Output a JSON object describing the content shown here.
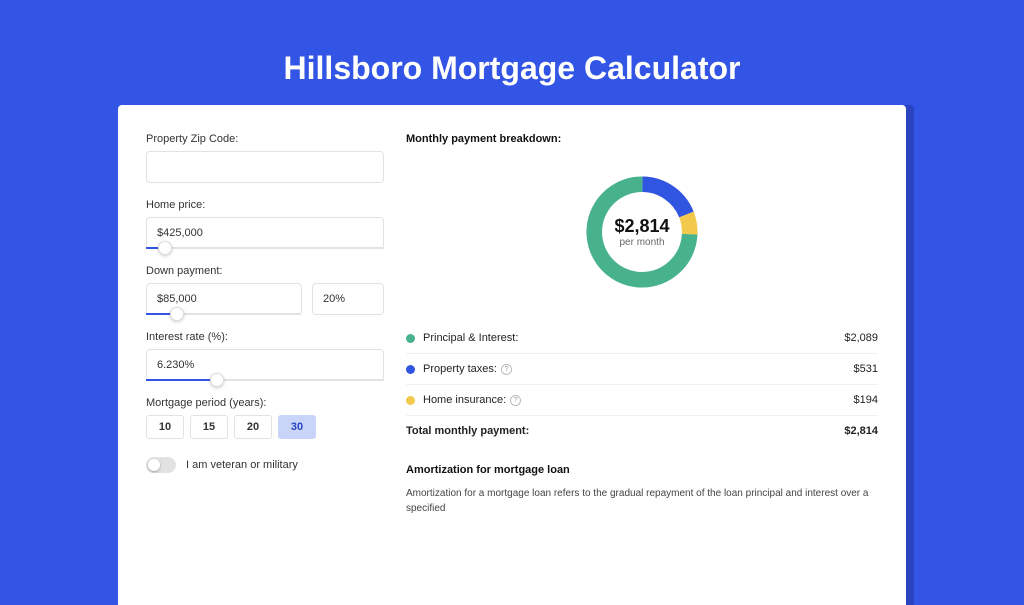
{
  "title": "Hillsboro Mortgage Calculator",
  "form": {
    "zip_label": "Property Zip Code:",
    "zip_value": "",
    "home_price_label": "Home price:",
    "home_price_value": "$425,000",
    "home_price_slider_pct": 8,
    "down_label": "Down payment:",
    "down_value": "$85,000",
    "down_percent": "20%",
    "down_slider_pct": 20,
    "rate_label": "Interest rate (%):",
    "rate_value": "6.230%",
    "rate_slider_pct": 30,
    "period_label": "Mortgage period (years):",
    "periods": [
      "10",
      "15",
      "20",
      "30"
    ],
    "period_active": "30",
    "veteran_label": "I am veteran or military"
  },
  "breakdown": {
    "title": "Monthly payment breakdown:",
    "donut_value": "$2,814",
    "donut_sub": "per month",
    "rows": [
      {
        "color": "#47b28c",
        "label": "Principal & Interest:",
        "info": false,
        "value": "$2,089"
      },
      {
        "color": "#3055e0",
        "label": "Property taxes:",
        "info": true,
        "value": "$531"
      },
      {
        "color": "#f2c94c",
        "label": "Home insurance:",
        "info": true,
        "value": "$194"
      }
    ],
    "total_label": "Total monthly payment:",
    "total_value": "$2,814"
  },
  "chart_data": {
    "type": "pie",
    "title": "Monthly payment breakdown",
    "series": [
      {
        "name": "Principal & Interest",
        "value": 2089,
        "color": "#47b28c"
      },
      {
        "name": "Property taxes",
        "value": 531,
        "color": "#3055e0"
      },
      {
        "name": "Home insurance",
        "value": 194,
        "color": "#f2c94c"
      }
    ],
    "total": 2814
  },
  "amortization": {
    "title": "Amortization for mortgage loan",
    "text": "Amortization for a mortgage loan refers to the gradual repayment of the loan principal and interest over a specified"
  }
}
